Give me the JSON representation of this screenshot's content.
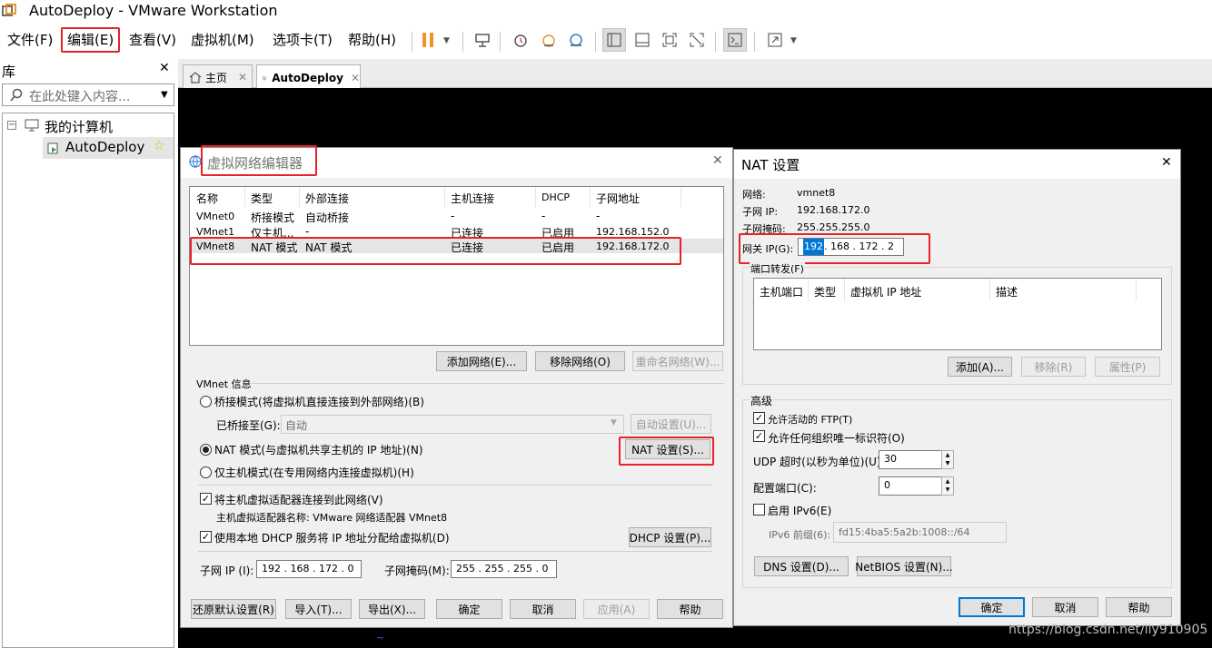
{
  "window": {
    "title": "AutoDeploy - VMware Workstation"
  },
  "menu": {
    "file": "文件(F)",
    "edit": "编辑(E)",
    "view": "查看(V)",
    "vm": "虚拟机(M)",
    "tabs": "选项卡(T)",
    "help": "帮助(H)"
  },
  "library": {
    "title": "库",
    "search_placeholder": "在此处键入内容...",
    "tree_root": "我的计算机",
    "tree_vm": "AutoDeploy"
  },
  "tabs": [
    {
      "label": "主页"
    },
    {
      "label": "AutoDeploy"
    }
  ],
  "vne": {
    "title": "虚拟网络编辑器",
    "columns": [
      "名称",
      "类型",
      "外部连接",
      "主机连接",
      "DHCP",
      "子网地址"
    ],
    "rows": [
      [
        "VMnet0",
        "桥接模式",
        "自动桥接",
        "-",
        "-",
        "-"
      ],
      [
        "VMnet1",
        "仅主机...",
        "-",
        "已连接",
        "已启用",
        "192.168.152.0"
      ],
      [
        "VMnet8",
        "NAT 模式",
        "NAT 模式",
        "已连接",
        "已启用",
        "192.168.172.0"
      ]
    ],
    "add_network": "添加网络(E)...",
    "remove_network": "移除网络(O)",
    "rename_network": "重命名网络(W)...",
    "vmnet_info": "VMnet 信息",
    "bridged_radio": "桥接模式(将虚拟机直接连接到外部网络)(B)",
    "bridged_to_label": "已桥接至(G):",
    "bridged_to_value": "自动",
    "auto_settings": "自动设置(U)...",
    "nat_radio": "NAT 模式(与虚拟机共享主机的 IP 地址)(N)",
    "nat_settings": "NAT 设置(S)...",
    "hostonly_radio": "仅主机模式(在专用网络内连接虚拟机)(H)",
    "connect_adapter": "将主机虚拟适配器连接到此网络(V)",
    "adapter_name": "主机虚拟适配器名称: VMware 网络适配器 VMnet8",
    "use_dhcp": "使用本地 DHCP 服务将 IP 地址分配给虚拟机(D)",
    "dhcp_settings": "DHCP 设置(P)...",
    "subnet_ip_label": "子网 IP (I):",
    "subnet_ip": "192 . 168 . 172 .  0",
    "subnet_mask_label": "子网掩码(M):",
    "subnet_mask": "255 . 255 . 255 .  0",
    "restore_defaults": "还原默认设置(R)",
    "import": "导入(T)...",
    "export": "导出(X)...",
    "ok": "确定",
    "cancel": "取消",
    "apply": "应用(A)",
    "help": "帮助"
  },
  "nat": {
    "title": "NAT 设置",
    "network_label": "网络:",
    "network_value": "vmnet8",
    "subnet_ip_label": "子网 IP:",
    "subnet_ip_value": "192.168.172.0",
    "subnet_mask_label": "子网掩码:",
    "subnet_mask_value": "255.255.255.0",
    "gateway_label": "网关 IP(G):",
    "gateway_first": "192",
    "gateway_rest": " . 168 . 172 .  2",
    "port_forwarding": "端口转发(F)",
    "pf_columns": [
      "主机端口",
      "类型",
      "虚拟机 IP 地址",
      "描述"
    ],
    "add": "添加(A)...",
    "remove": "移除(R)",
    "properties": "属性(P)",
    "advanced": "高级",
    "allow_ftp": "允许活动的 FTP(T)",
    "allow_oui": "允许任何组织唯一标识符(O)",
    "udp_timeout_label": "UDP 超时(以秒为单位)(U):",
    "udp_timeout": "30",
    "config_port_label": "配置端口(C):",
    "config_port": "0",
    "enable_ipv6": "启用 IPv6(E)",
    "ipv6_prefix_label": "IPv6 前缀(6):",
    "ipv6_prefix": "fd15:4ba5:5a2b:1008::/64",
    "dns_settings": "DNS 设置(D)...",
    "netbios_settings": "NetBIOS 设置(N)...",
    "ok": "确定",
    "cancel": "取消",
    "help": "帮助"
  },
  "watermark": "https://blog.csdn.net/lly910905",
  "colors": {
    "highlight": "#e8212b",
    "selection": "#0078d7",
    "vm_background": "#000000"
  }
}
